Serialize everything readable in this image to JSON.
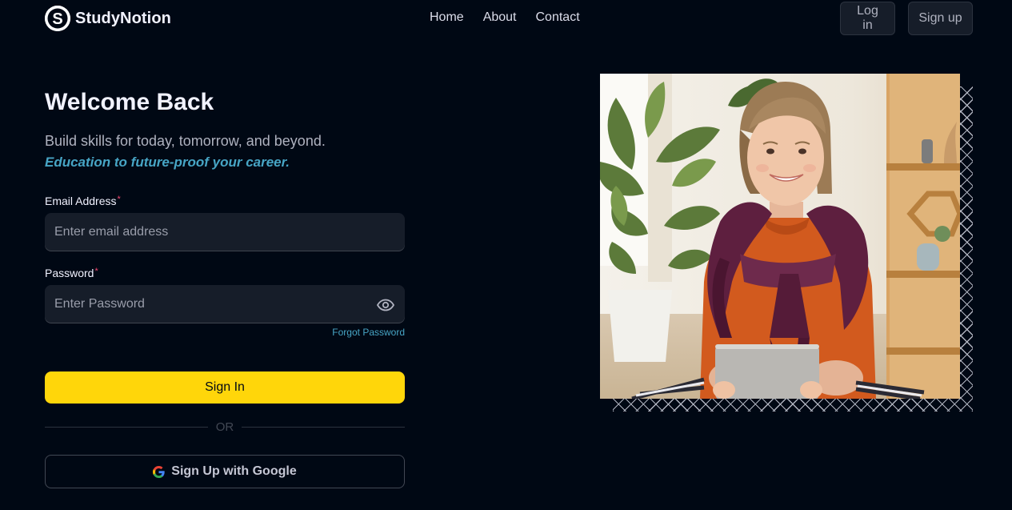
{
  "brand": {
    "name": "StudyNotion"
  },
  "nav": {
    "links": [
      "Home",
      "About",
      "Contact"
    ],
    "login_label": "Log in",
    "signup_label": "Sign up"
  },
  "login": {
    "title": "Welcome Back",
    "description": "Build skills for today, tomorrow, and beyond.",
    "highlight": "Education to future-proof your career.",
    "email": {
      "label": "Email Address",
      "placeholder": "Enter email address",
      "value": ""
    },
    "password": {
      "label": "Password",
      "placeholder": "Enter Password",
      "value": ""
    },
    "required_mark": "*",
    "forgot_label": "Forgot Password",
    "submit_label": "Sign In",
    "divider_text": "OR",
    "google_label": "Sign Up with Google"
  },
  "icons": {
    "logo": "studynotion-logo-icon",
    "password_toggle": "eye-icon",
    "google": "google-icon"
  },
  "colors": {
    "background": "#000814",
    "accent": "#FFD60A",
    "link": "#47A5C5",
    "required": "#EF476F",
    "input_bg": "#161D29"
  }
}
